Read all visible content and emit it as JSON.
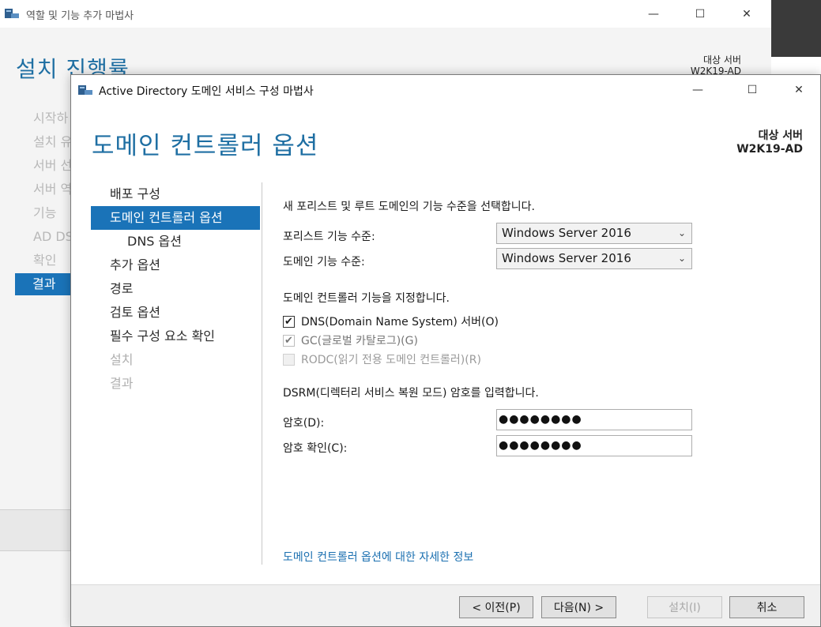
{
  "background_window": {
    "title": "역할 및 기능 추가 마법사",
    "heading": "설치 진행률",
    "target_label": "대상 서버",
    "target_server": "W2K19-AD",
    "nav_items": [
      "시작하",
      "설치 유",
      "서버 선",
      "서버 역",
      "기능",
      "AD DS",
      "확인",
      "결과"
    ],
    "active_nav_index": 7
  },
  "window": {
    "title": "Active Directory 도메인 서비스 구성 마법사",
    "heading": "도메인 컨트롤러 옵션",
    "target_label": "대상 서버",
    "target_server": "W2K19-AD",
    "minimize_symbol": "—",
    "maximize_symbol": "☐",
    "close_symbol": "✕"
  },
  "nav": {
    "items": [
      {
        "label": "배포 구성",
        "state": "normal"
      },
      {
        "label": "도메인 컨트롤러 옵션",
        "state": "active"
      },
      {
        "label": "DNS 옵션",
        "state": "sub"
      },
      {
        "label": "추가 옵션",
        "state": "normal"
      },
      {
        "label": "경로",
        "state": "normal"
      },
      {
        "label": "검토 옵션",
        "state": "normal"
      },
      {
        "label": "필수 구성 요소 확인",
        "state": "normal"
      },
      {
        "label": "설치",
        "state": "disabled"
      },
      {
        "label": "결과",
        "state": "disabled"
      }
    ]
  },
  "content": {
    "functional_level_prompt": "새 포리스트 및 루트 도메인의 기능 수준을 선택합니다.",
    "forest_level_label": "포리스트 기능 수준:",
    "forest_level_value": "Windows Server 2016",
    "domain_level_label": "도메인 기능 수준:",
    "domain_level_value": "Windows Server 2016",
    "capabilities_prompt": "도메인 컨트롤러 기능을 지정합니다.",
    "checkboxes": [
      {
        "label": "DNS(Domain Name System) 서버(O)",
        "checked": true,
        "state": "enabled"
      },
      {
        "label": "GC(글로벌 카탈로그)(G)",
        "checked": true,
        "state": "greyed"
      },
      {
        "label": "RODC(읽기 전용 도메인 컨트롤러)(R)",
        "checked": false,
        "state": "disabled"
      }
    ],
    "dsrm_prompt": "DSRM(디렉터리 서비스 복원 모드) 암호를 입력합니다.",
    "password_label": "암호(D):",
    "password_value": "●●●●●●●●",
    "confirm_label": "암호 확인(C):",
    "confirm_value": "●●●●●●●●",
    "more_info_link": "도메인 컨트롤러 옵션에 대한 자세한 정보"
  },
  "footer": {
    "previous_label": "< 이전(P)",
    "next_label": "다음(N) >",
    "install_label": "설치(I)",
    "cancel_label": "취소"
  },
  "colors": {
    "accent": "#1a73b8",
    "heading": "#1f6fa3",
    "link": "#1a6fb0"
  }
}
